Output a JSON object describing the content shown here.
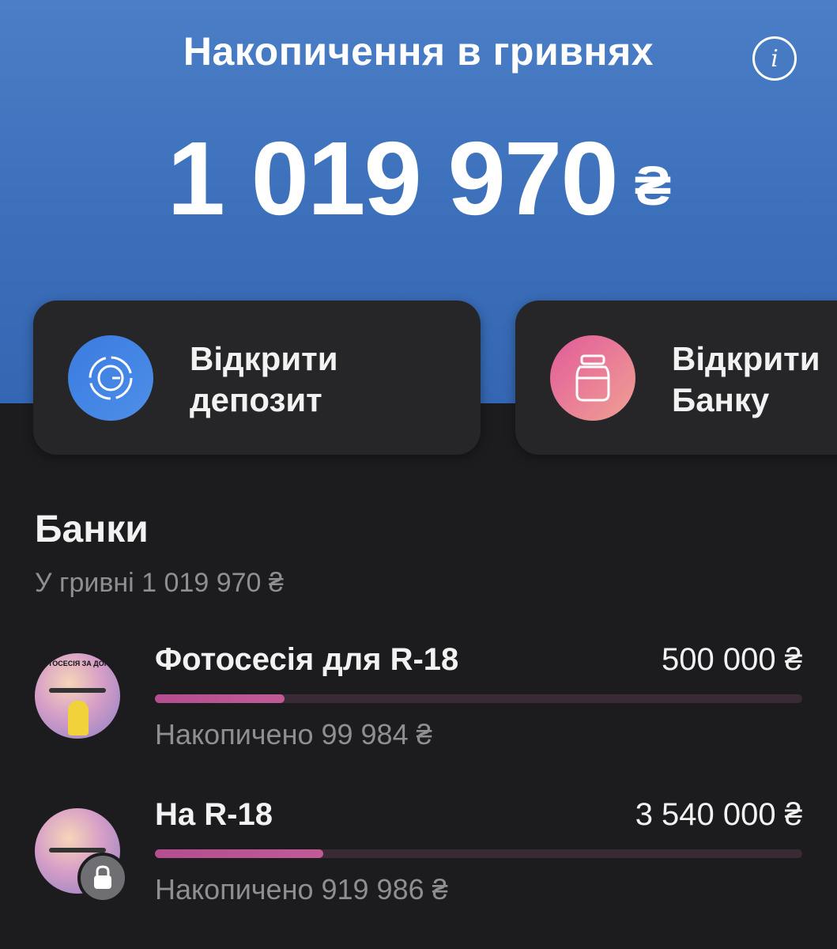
{
  "header": {
    "title": "Накопичення в гривнях",
    "info_icon": "info-icon",
    "balance": "1 019 970",
    "currency": "₴"
  },
  "actions": [
    {
      "label": "Відкрити\nдепозит",
      "icon": "deposit-target-icon",
      "color": "#3a7be0"
    },
    {
      "label": "Відкрити\nБанку",
      "icon": "jar-icon",
      "color": "#e25a9a"
    }
  ],
  "banks": {
    "title": "Банки",
    "subtitle": "У гривні 1 019 970 ₴",
    "items": [
      {
        "name": "Фотосесія для R-18",
        "goal": "500 000 ₴",
        "saved": "Накопичено 99 984 ₴",
        "progress": 0.2,
        "avatar_caption": "ФОТОСЕСІЯ ЗА ДОНАТ",
        "locked": false
      },
      {
        "name": "На R-18",
        "goal": "3 540 000 ₴",
        "saved": "Накопичено 919 986 ₴",
        "progress": 0.26,
        "locked": true,
        "lock_icon": "lock-icon"
      }
    ]
  },
  "colors": {
    "accent_blue": "#3c6fba",
    "progress": "#b34e8f",
    "background": "#1c1c1e"
  }
}
